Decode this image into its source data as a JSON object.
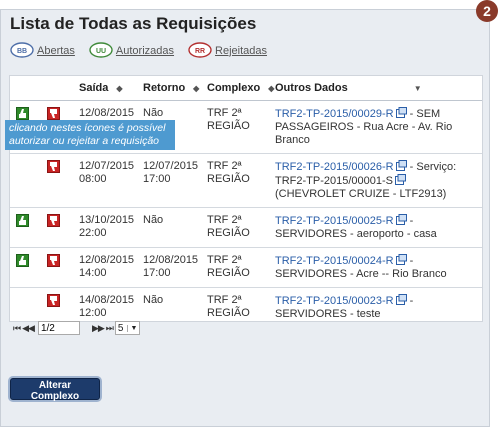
{
  "step_badge": "2",
  "page_title": "Lista de Todas as Requisições",
  "filters": [
    {
      "code": "BB",
      "label": "Abertas",
      "color": "#4d6ea8"
    },
    {
      "code": "UU",
      "label": "Autorizadas",
      "color": "#3f8a3a"
    },
    {
      "code": "RR",
      "label": "Rejeitadas",
      "color": "#b33030"
    }
  ],
  "table": {
    "columns": [
      "Saída",
      "Retorno",
      "Complexo",
      "Outros Dados"
    ],
    "rows": [
      {
        "saida": "12/08/2015 12:00",
        "retorno": "Não",
        "complexo": "TRF 2ª REGIÃO",
        "req_id": "TRF2-TP-2015/00029-R",
        "details": " - SEM PASSAGEIROS - Rua Acre - Av. Rio Branco",
        "extra": ""
      },
      {
        "saida": "12/07/2015 08:00",
        "retorno": "12/07/2015 17:00",
        "complexo": "TRF 2ª REGIÃO",
        "req_id": "TRF2-TP-2015/00026-R",
        "details": " - Serviço: TRF2-TP-2015/00001-S",
        "extra": "(CHEVROLET CRUIZE - LTF2913)"
      },
      {
        "saida": "13/10/2015 22:00",
        "retorno": "Não",
        "complexo": "TRF 2ª REGIÃO",
        "req_id": "TRF2-TP-2015/00025-R",
        "details": " - SERVIDORES - aeroporto - casa",
        "extra": ""
      },
      {
        "saida": "12/08/2015 14:00",
        "retorno": "12/08/2015 17:00",
        "complexo": "TRF 2ª REGIÃO",
        "req_id": "TRF2-TP-2015/00024-R",
        "details": " - SERVIDORES - Acre -- Rio Branco",
        "extra": ""
      },
      {
        "saida": "14/08/2015 12:00",
        "retorno": "Não",
        "complexo": "TRF 2ª REGIÃO",
        "req_id": "TRF2-TP-2015/00023-R",
        "details": " - SERVIDORES - teste",
        "extra": ""
      }
    ]
  },
  "tooltip": "clicando nestes ícones é possível autorizar ou rejeitar a requisição",
  "pager": {
    "first": "⏮",
    "prev": "◀◀",
    "page": "1/2",
    "next": "▶▶",
    "last": "⏭",
    "page_size": "5"
  },
  "button_label": "Alterar Complexo"
}
